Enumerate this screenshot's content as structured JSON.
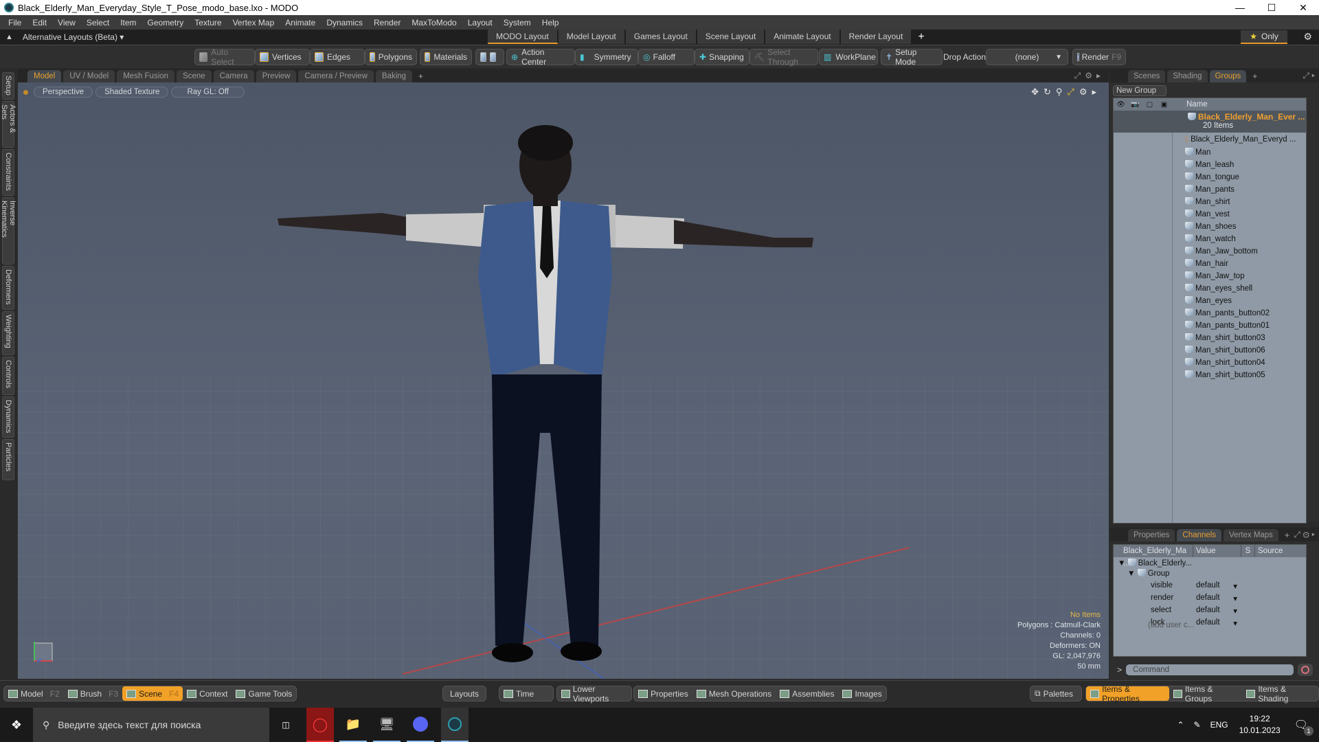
{
  "window": {
    "title": "Black_Elderly_Man_Everyday_Style_T_Pose_modo_base.lxo - MODO",
    "controls": [
      "minimize",
      "maximize",
      "close"
    ]
  },
  "menu": [
    "File",
    "Edit",
    "View",
    "Select",
    "Item",
    "Geometry",
    "Texture",
    "Vertex Map",
    "Animate",
    "Dynamics",
    "Render",
    "MaxToModo",
    "Layout",
    "System",
    "Help"
  ],
  "layouts": {
    "switcher": "Alternative Layouts (Beta)",
    "tabs": [
      {
        "label": "MODO Layout",
        "active": true
      },
      {
        "label": "Model Layout"
      },
      {
        "label": "Games Layout"
      },
      {
        "label": "Scene Layout"
      },
      {
        "label": "Animate Layout"
      },
      {
        "label": "Render Layout"
      }
    ],
    "add": "+",
    "only": "Only"
  },
  "toolbar": {
    "auto_select": "Auto Select",
    "vertices": "Vertices",
    "edges": "Edges",
    "polygons": "Polygons",
    "materials": "Materials",
    "action_center": "Action Center",
    "symmetry": "Symmetry",
    "falloff": "Falloff",
    "snapping": "Snapping",
    "select_through": "Select Through",
    "workplane": "WorkPlane",
    "setup_mode": "Setup Mode",
    "drop_action_label": "Drop Action",
    "drop_action_value": "(none)",
    "render": "Render",
    "render_key": "F9"
  },
  "side_tabs": [
    "Setup",
    "Actors & Sets",
    "Constraints",
    "Inverse Kinematics",
    "Deformers",
    "Weighting",
    "Controls",
    "Dynamics",
    "Particles"
  ],
  "viewport_tabs": [
    {
      "label": "Model",
      "active": true
    },
    {
      "label": "UV / Model"
    },
    {
      "label": "Mesh Fusion"
    },
    {
      "label": "Scene"
    },
    {
      "label": "Camera"
    },
    {
      "label": "Preview"
    },
    {
      "label": "Camera / Preview"
    },
    {
      "label": "Baking"
    }
  ],
  "viewport": {
    "view": "Perspective",
    "shading": "Shaded Texture",
    "raygl": "Ray GL: Off",
    "info": {
      "selection": "No Items",
      "polygons": "Polygons : Catmull-Clark",
      "channels": "Channels: 0",
      "deformers": "Deformers: ON",
      "gl": "GL: 2,047,976",
      "focal": "50 mm"
    },
    "gizmo_axis": "Y"
  },
  "right_tabs": [
    {
      "label": "Scenes"
    },
    {
      "label": "Shading"
    },
    {
      "label": "Groups",
      "active": true
    }
  ],
  "groups": {
    "new_group": "New Group",
    "column_name": "Name",
    "root": {
      "name": "Black_Elderly_Man_Ever ...",
      "count": "20 Items"
    },
    "items": [
      {
        "name": "Black_Elderly_Man_Everyd ...",
        "icon": "locator-icon"
      },
      {
        "name": "Man",
        "icon": "mesh-icon"
      },
      {
        "name": "Man_leash",
        "icon": "mesh-icon"
      },
      {
        "name": "Man_tongue",
        "icon": "mesh-icon"
      },
      {
        "name": "Man_pants",
        "icon": "mesh-icon"
      },
      {
        "name": "Man_shirt",
        "icon": "mesh-icon"
      },
      {
        "name": "Man_vest",
        "icon": "mesh-icon"
      },
      {
        "name": "Man_shoes",
        "icon": "mesh-icon"
      },
      {
        "name": "Man_watch",
        "icon": "mesh-icon"
      },
      {
        "name": "Man_Jaw_bottom",
        "icon": "mesh-icon"
      },
      {
        "name": "Man_hair",
        "icon": "mesh-icon"
      },
      {
        "name": "Man_Jaw_top",
        "icon": "mesh-icon"
      },
      {
        "name": "Man_eyes_shell",
        "icon": "mesh-icon"
      },
      {
        "name": "Man_eyes",
        "icon": "mesh-icon"
      },
      {
        "name": "Man_pants_button02",
        "icon": "mesh-icon"
      },
      {
        "name": "Man_pants_button01",
        "icon": "mesh-icon"
      },
      {
        "name": "Man_shirt_button03",
        "icon": "mesh-icon"
      },
      {
        "name": "Man_shirt_button06",
        "icon": "mesh-icon"
      },
      {
        "name": "Man_shirt_button04",
        "icon": "mesh-icon"
      },
      {
        "name": "Man_shirt_button05",
        "icon": "mesh-icon"
      }
    ]
  },
  "channel_tabs": [
    {
      "label": "Properties"
    },
    {
      "label": "Channels",
      "active": true
    },
    {
      "label": "Vertex Maps"
    }
  ],
  "channels": {
    "headers": [
      "Black_Elderly_Ma ...",
      "Value",
      "S",
      "Source"
    ],
    "item": "Black_Elderly...",
    "group": "Group",
    "rows": [
      {
        "name": "visible",
        "value": "default"
      },
      {
        "name": "render",
        "value": "default"
      },
      {
        "name": "select",
        "value": "default"
      },
      {
        "name": "lock",
        "value": "default"
      }
    ],
    "add_user": "(add user c..."
  },
  "command": {
    "prompt": ">",
    "placeholder": "Command"
  },
  "bottom": {
    "modes": [
      {
        "label": "Model",
        "key": "F2"
      },
      {
        "label": "Brush",
        "key": "F3"
      },
      {
        "label": "Scene",
        "key": "F4",
        "active": true
      },
      {
        "label": "Context"
      },
      {
        "label": "Game Tools"
      }
    ],
    "layouts": "Layouts",
    "time": "Time",
    "lower_viewports": "Lower Viewports",
    "palettes_mid": [
      "Properties",
      "Mesh Operations",
      "Assemblies",
      "Images"
    ],
    "palettes": "Palettes",
    "right": [
      {
        "label": "Items & Properties",
        "active": true
      },
      {
        "label": "Items & Groups"
      },
      {
        "label": "Items & Shading"
      }
    ]
  },
  "taskbar": {
    "search_placeholder": "Введите здесь текст для поиска",
    "lang": "ENG",
    "time": "19:22",
    "date": "10.01.2023",
    "notifications": "1"
  }
}
